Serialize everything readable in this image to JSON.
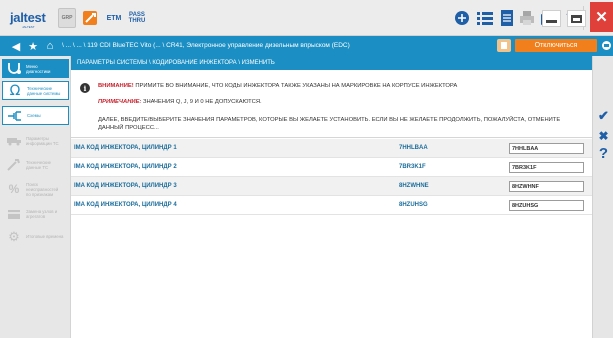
{
  "toolbar": {
    "logo": "jaltest",
    "logo_sub": "JALTEST",
    "grp_label": "GRP",
    "etm_label": "ETM",
    "pass_label": "PASS\nTHRU"
  },
  "nav": {
    "breadcrumb": "\\ ... \\ ... \\ 119 CDI BlueTEC Vito (... \\ CR41, Электронное управление дизельным впрыском (EDC)",
    "disconnect_label": "Отключиться"
  },
  "sidebar": {
    "items": [
      {
        "label": "Меню\nдиагностики"
      },
      {
        "label": "Технические\nданные системы"
      },
      {
        "label": "Схемы"
      },
      {
        "label": "Параметры\nинформации ТС"
      },
      {
        "label": "Технические\nданные ТС"
      },
      {
        "label": "Поиск\nнеисправностей\nпо признакам"
      },
      {
        "label": "Замена узлов и\nагрегатов"
      },
      {
        "label": "Итоговые времена"
      }
    ]
  },
  "content": {
    "header": "ПАРАМЕТРЫ СИСТЕМЫ \\ КОДИРОВАНИЕ ИНЖЕКТОРА \\ ИЗМЕНИТЬ",
    "warning_label": "ВНИМАНИЕ!",
    "warning_text": " ПРИМИТЕ ВО ВНИМАНИЕ, ЧТО КОДЫ ИНЖЕКТОРА ТАКЖЕ УКАЗАНЫ НА МАРКИРОВКЕ НА КОРПУСЕ ИНЖЕКТОРА",
    "note_label": "ПРИМЕЧАНИЕ:",
    "note_text": " ЗНАЧЕНИЯ Q, J, 9 И 0 НЕ ДОПУСКАЮТСЯ.",
    "instruction": "ДАЛЕЕ, ВВЕДИТЕ/ВЫБЕРИТЕ ЗНАЧЕНИЯ ПАРАМЕТРОВ, КОТОРЫЕ ВЫ ЖЕЛАЕТЕ УСТАНОВИТЬ. ЕСЛИ ВЫ НЕ ЖЕЛАЕТЕ ПРОДОЛЖИТЬ, ПОЖАЛУЙСТА, ОТМЕНИТЕ ДАННЫЙ ПРОЦЕСС...",
    "rows": [
      {
        "name": "IMA КОД ИНЖЕКТОРА, ЦИЛИНДР 1",
        "code": "7HHLBAA",
        "value": "7HHLBAA"
      },
      {
        "name": "IMA КОД ИНЖЕКТОРА, ЦИЛИНДР 2",
        "code": "7BR3K1F",
        "value": "7BR3K1F"
      },
      {
        "name": "IMA КОД ИНЖЕКТОРА, ЦИЛИНДР 3",
        "code": "8HZWHNE",
        "value": "8HZWHNF"
      },
      {
        "name": "IMA КОД ИНЖЕКТОРА, ЦИЛИНДР 4",
        "code": "8HZUHSG",
        "value": "8HZUHSG"
      }
    ]
  },
  "rail": {
    "accept": "✔",
    "cancel": "✖",
    "help": "?"
  },
  "colors": {
    "accent_blue": "#1b8fc4",
    "orange": "#f07f1c",
    "warning_red": "#c8202a",
    "close_red": "#e0403a"
  }
}
